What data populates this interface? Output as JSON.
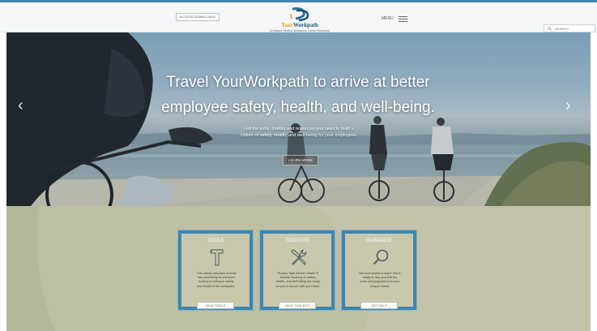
{
  "header": {
    "downloads_label": "ACCESS DOWNLOADS",
    "brand": {
      "name_your": "Your",
      "name_rest": "Workpath",
      "tagline": "A Oregon Healthy Workforce Center Resource"
    },
    "menu_label": "MENU",
    "search": {
      "placeholder": "SEARCH",
      "value": ""
    },
    "icons": {
      "menu": "hamburger-icon",
      "search": "search-icon",
      "logo": "logo-mark-icon"
    }
  },
  "hero": {
    "title_line1": "Travel YourWorkpath to arrive at better",
    "title_line2": "employee safety, health, and well-being.",
    "subtitle_line1": "Get the tools, toolkits and resources you need to build a",
    "subtitle_line2": "culture of safety, health, and well-being for your employees.",
    "button_label": "LEARN MORE",
    "prev_arrow": "‹",
    "next_arrow": "›"
  },
  "cards": [
    {
      "title": "TOOLS",
      "icon": "hammer-icon",
      "desc_lines": [
        "This robust collection of tools",
        "has something for everyone",
        "looking to enhance safety",
        "and health in the workplace."
      ],
      "button_label": "VIEW TOOLS"
    },
    {
      "title": "TOOLKITS",
      "icon": "wrench-screwdriver-icon",
      "desc_lines": [
        "Proven Total Worker Health ®",
        "toolkits focusing on safety,",
        "health, and well-being are ready",
        "for you to launch with your team."
      ],
      "button_label": "VIEW TOOLKITS"
    },
    {
      "title": "GUIDANCE",
      "icon": "magnifier-icon",
      "desc_lines": [
        "Not sure where to start? We're",
        "ready to help you find the",
        "tools and programs to fit your",
        "unique needs."
      ],
      "button_label": "GET HELP"
    }
  ],
  "colors": {
    "accent_blue": "#3f86b0",
    "brand_navy": "#1c5278",
    "brand_gold": "#e0a21d",
    "card_bg": "#c9c8ad",
    "section_bg": "#bdbfa3"
  }
}
